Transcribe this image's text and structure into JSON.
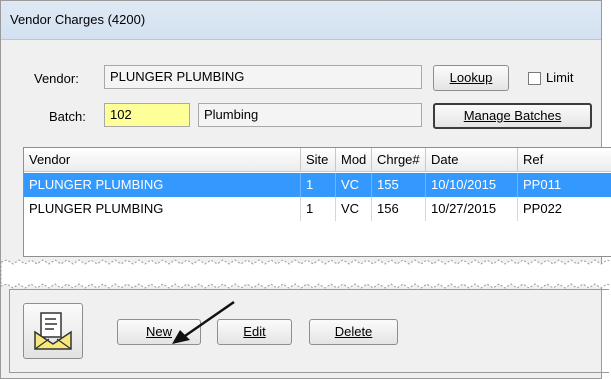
{
  "window": {
    "title": "Vendor Charges (4200)"
  },
  "vendor": {
    "label": "Vendor:",
    "value": "PLUNGER PLUMBING",
    "lookup_label": "Lookup",
    "limit_label": "Limit"
  },
  "batch": {
    "label": "Batch:",
    "number": "102",
    "name": "Plumbing",
    "manage_label": "Manage Batches"
  },
  "grid": {
    "columns": [
      "Vendor",
      "Site",
      "Mod",
      "Chrge#",
      "Date",
      "Ref"
    ],
    "rows": [
      {
        "vendor": "PLUNGER PLUMBING",
        "site": "1",
        "mod": "VC",
        "charge": "155",
        "date": "10/10/2015",
        "ref": "PP011"
      },
      {
        "vendor": "PLUNGER PLUMBING",
        "site": "1",
        "mod": "VC",
        "charge": "156",
        "date": "10/27/2015",
        "ref": "PP022"
      }
    ]
  },
  "actions": {
    "new_label": "New",
    "edit_label": "Edit",
    "delete_label": "Delete"
  },
  "icons": {
    "mail": "envelope-document-icon",
    "pointer": "arrow-pointer-icon"
  },
  "colors": {
    "selection": "#3399ff",
    "batch_highlight": "#ffff99"
  }
}
